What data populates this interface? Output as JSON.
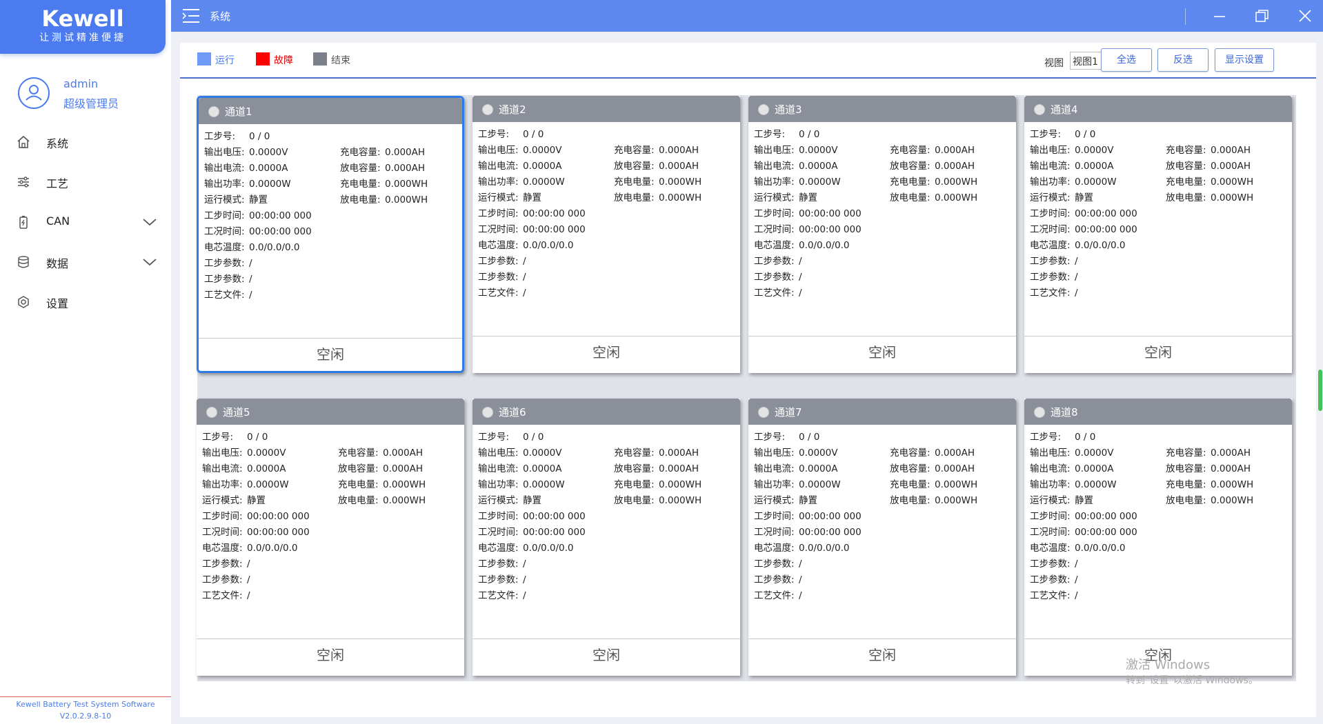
{
  "brand": {
    "name": "Kewell",
    "slogan": "让测试精准便捷"
  },
  "user": {
    "name": "admin",
    "role": "超级管理员"
  },
  "nav": [
    {
      "label": "系统",
      "icon": "home-icon",
      "has_children": false
    },
    {
      "label": "工艺",
      "icon": "process-icon",
      "has_children": false
    },
    {
      "label": "CAN",
      "icon": "battery-icon",
      "has_children": true
    },
    {
      "label": "数据",
      "icon": "database-icon",
      "has_children": true
    },
    {
      "label": "设置",
      "icon": "settings-icon",
      "has_children": false
    }
  ],
  "footer": {
    "line1": "Kewell Battery Test System Software",
    "line2": "V2.0.2.9.8-10"
  },
  "titlebar": {
    "title": "系统"
  },
  "legend": [
    {
      "label": "运行",
      "color": "#6f9af5",
      "text_color": "#4b7bef"
    },
    {
      "label": "故障",
      "color": "#ff0000",
      "text_color": "#e00000"
    },
    {
      "label": "结束",
      "color": "#7b808a",
      "text_color": "#555555"
    }
  ],
  "toolbar": {
    "view_label": "视图",
    "view_value": "视图1",
    "select_all": "全选",
    "invert": "反选",
    "display_settings": "显示设置"
  },
  "labels": {
    "step_no": "工步号:",
    "out_voltage": "输出电压:",
    "out_current": "输出电流:",
    "out_power": "输出功率:",
    "run_mode": "运行模式:",
    "step_time": "工步时间:",
    "cond_time": "工况时间:",
    "cell_temp": "电芯温度:",
    "step_param": "工步参数:",
    "process_file": "工艺文件:",
    "charge_cap": "充电容量:",
    "discharge_cap": "放电容量:",
    "charge_energy": "充电电量:",
    "discharge_energy": "放电电量:"
  },
  "channels": [
    {
      "name": "通道1",
      "selected": true,
      "step_no": "0 / 0",
      "out_voltage": "0.0000V",
      "out_current": "0.0000A",
      "out_power": "0.0000W",
      "run_mode": "静置",
      "step_time": "00:00:00 000",
      "cond_time": "00:00:00 000",
      "cell_temp": "0.0/0.0/0.0",
      "step_param1": "/",
      "step_param2": "/",
      "process_file": "/",
      "charge_cap": "0.000AH",
      "discharge_cap": "0.000AH",
      "charge_energy": "0.000WH",
      "discharge_energy": "0.000WH",
      "status": "空闲"
    },
    {
      "name": "通道2",
      "selected": false,
      "step_no": "0 / 0",
      "out_voltage": "0.0000V",
      "out_current": "0.0000A",
      "out_power": "0.0000W",
      "run_mode": "静置",
      "step_time": "00:00:00 000",
      "cond_time": "00:00:00 000",
      "cell_temp": "0.0/0.0/0.0",
      "step_param1": "/",
      "step_param2": "/",
      "process_file": "/",
      "charge_cap": "0.000AH",
      "discharge_cap": "0.000AH",
      "charge_energy": "0.000WH",
      "discharge_energy": "0.000WH",
      "status": "空闲"
    },
    {
      "name": "通道3",
      "selected": false,
      "step_no": "0 / 0",
      "out_voltage": "0.0000V",
      "out_current": "0.0000A",
      "out_power": "0.0000W",
      "run_mode": "静置",
      "step_time": "00:00:00 000",
      "cond_time": "00:00:00 000",
      "cell_temp": "0.0/0.0/0.0",
      "step_param1": "/",
      "step_param2": "/",
      "process_file": "/",
      "charge_cap": "0.000AH",
      "discharge_cap": "0.000AH",
      "charge_energy": "0.000WH",
      "discharge_energy": "0.000WH",
      "status": "空闲"
    },
    {
      "name": "通道4",
      "selected": false,
      "step_no": "0 / 0",
      "out_voltage": "0.0000V",
      "out_current": "0.0000A",
      "out_power": "0.0000W",
      "run_mode": "静置",
      "step_time": "00:00:00 000",
      "cond_time": "00:00:00 000",
      "cell_temp": "0.0/0.0/0.0",
      "step_param1": "/",
      "step_param2": "/",
      "process_file": "/",
      "charge_cap": "0.000AH",
      "discharge_cap": "0.000AH",
      "charge_energy": "0.000WH",
      "discharge_energy": "0.000WH",
      "status": "空闲"
    },
    {
      "name": "通道5",
      "selected": false,
      "step_no": "0 / 0",
      "out_voltage": "0.0000V",
      "out_current": "0.0000A",
      "out_power": "0.0000W",
      "run_mode": "静置",
      "step_time": "00:00:00 000",
      "cond_time": "00:00:00 000",
      "cell_temp": "0.0/0.0/0.0",
      "step_param1": "/",
      "step_param2": "/",
      "process_file": "/",
      "charge_cap": "0.000AH",
      "discharge_cap": "0.000AH",
      "charge_energy": "0.000WH",
      "discharge_energy": "0.000WH",
      "status": "空闲"
    },
    {
      "name": "通道6",
      "selected": false,
      "step_no": "0 / 0",
      "out_voltage": "0.0000V",
      "out_current": "0.0000A",
      "out_power": "0.0000W",
      "run_mode": "静置",
      "step_time": "00:00:00 000",
      "cond_time": "00:00:00 000",
      "cell_temp": "0.0/0.0/0.0",
      "step_param1": "/",
      "step_param2": "/",
      "process_file": "/",
      "charge_cap": "0.000AH",
      "discharge_cap": "0.000AH",
      "charge_energy": "0.000WH",
      "discharge_energy": "0.000WH",
      "status": "空闲"
    },
    {
      "name": "通道7",
      "selected": false,
      "step_no": "0 / 0",
      "out_voltage": "0.0000V",
      "out_current": "0.0000A",
      "out_power": "0.0000W",
      "run_mode": "静置",
      "step_time": "00:00:00 000",
      "cond_time": "00:00:00 000",
      "cell_temp": "0.0/0.0/0.0",
      "step_param1": "/",
      "step_param2": "/",
      "process_file": "/",
      "charge_cap": "0.000AH",
      "discharge_cap": "0.000AH",
      "charge_energy": "0.000WH",
      "discharge_energy": "0.000WH",
      "status": "空闲"
    },
    {
      "name": "通道8",
      "selected": false,
      "step_no": "0 / 0",
      "out_voltage": "0.0000V",
      "out_current": "0.0000A",
      "out_power": "0.0000W",
      "run_mode": "静置",
      "step_time": "00:00:00 000",
      "cond_time": "00:00:00 000",
      "cell_temp": "0.0/0.0/0.0",
      "step_param1": "/",
      "step_param2": "/",
      "process_file": "/",
      "charge_cap": "0.000AH",
      "discharge_cap": "0.000AH",
      "charge_energy": "0.000WH",
      "discharge_energy": "0.000WH",
      "status": "空闲"
    }
  ],
  "watermark": {
    "line1": "激活 Windows",
    "line2": "转到\"设置\"以激活 Windows。"
  }
}
